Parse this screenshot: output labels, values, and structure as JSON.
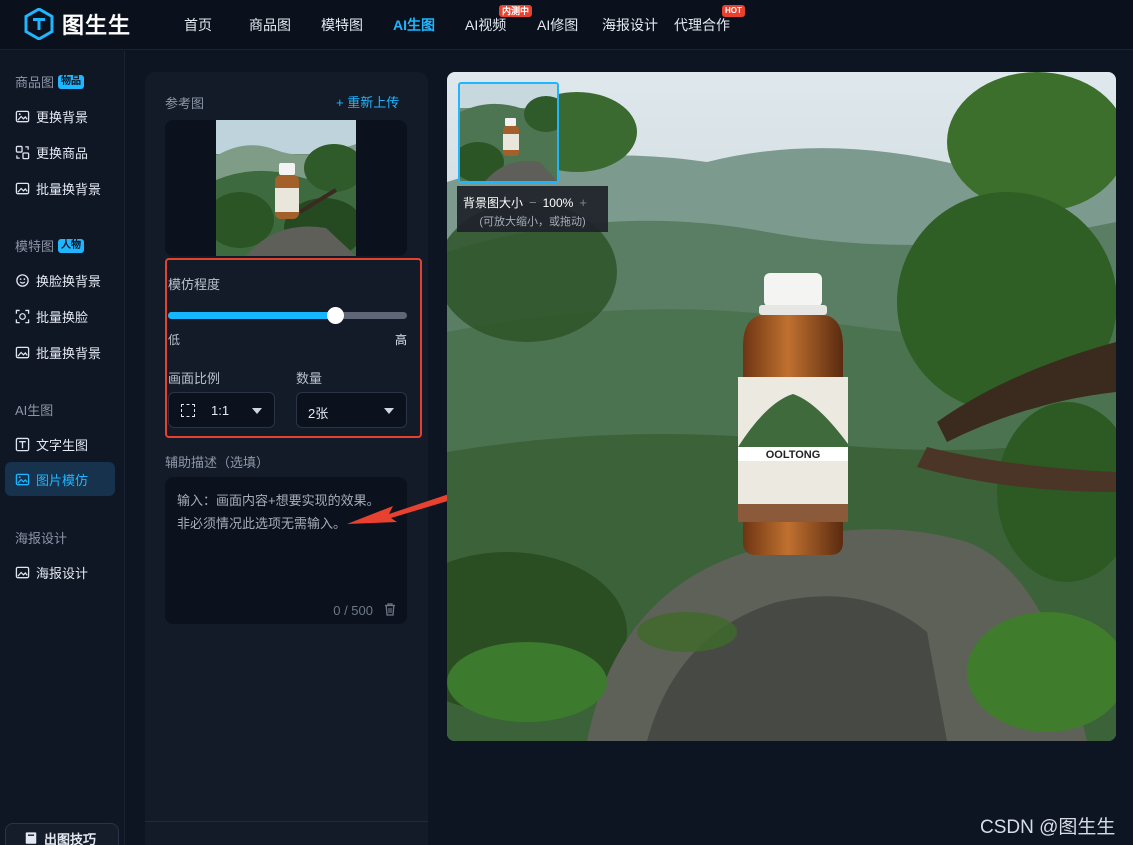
{
  "brand": {
    "name": "图生生"
  },
  "nav": {
    "items": [
      {
        "label": "首页",
        "active": false
      },
      {
        "label": "商品图",
        "active": false
      },
      {
        "label": "模特图",
        "active": false
      },
      {
        "label": "AI生图",
        "active": true
      },
      {
        "label": "AI视频",
        "active": false,
        "badge": "内测中"
      },
      {
        "label": "AI修图",
        "active": false
      },
      {
        "label": "海报设计",
        "active": false
      },
      {
        "label": "代理合作",
        "active": false,
        "badge": "HOT"
      }
    ]
  },
  "sidebar": {
    "groups": [
      {
        "label": "商品图",
        "tag": "物品",
        "items": [
          {
            "label": "更换背景",
            "icon": "image-swap-icon"
          },
          {
            "label": "更换商品",
            "icon": "product-swap-icon"
          },
          {
            "label": "批量换背景",
            "icon": "batch-bg-icon"
          }
        ]
      },
      {
        "label": "模特图",
        "tag": "人物",
        "items": [
          {
            "label": "换脸换背景",
            "icon": "face-bg-icon"
          },
          {
            "label": "批量换脸",
            "icon": "face-scan-icon"
          },
          {
            "label": "批量换背景",
            "icon": "batch-bg-icon"
          }
        ]
      },
      {
        "label": "AI生图",
        "tag": "",
        "items": [
          {
            "label": "文字生图",
            "icon": "text-image-icon"
          },
          {
            "label": "图片模仿",
            "icon": "image-imitate-icon",
            "active": true
          }
        ]
      },
      {
        "label": "海报设计",
        "tag": "",
        "items": [
          {
            "label": "海报设计",
            "icon": "poster-icon"
          }
        ]
      }
    ],
    "footer": {
      "label": "出图技巧",
      "icon": "book-icon"
    }
  },
  "panel": {
    "reference_label": "参考图",
    "reupload_label": "+ 重新上传",
    "imitation": {
      "label": "模仿程度",
      "low": "低",
      "high": "高",
      "value": 0.7
    },
    "ratio": {
      "label": "画面比例",
      "value": "1:1"
    },
    "count": {
      "label": "数量",
      "value": "2张"
    },
    "description": {
      "label": "辅助描述（选填）",
      "placeholder": "输入：画面内容+想要实现的效果。非必须情况此选项无需输入。",
      "counter": "0 / 500"
    }
  },
  "preview": {
    "bg_size_label": "背景图大小",
    "minus": "−",
    "zoom": "100%",
    "plus": "+",
    "hint": "(可放大缩小，或拖动)",
    "bottle_label": "OOLTONG"
  },
  "watermark": "CSDN @图生生",
  "colors": {
    "accent": "#1fb6ff",
    "highlight": "#e2422e",
    "arrow": "#e8412f",
    "badge": "#e8412f"
  }
}
